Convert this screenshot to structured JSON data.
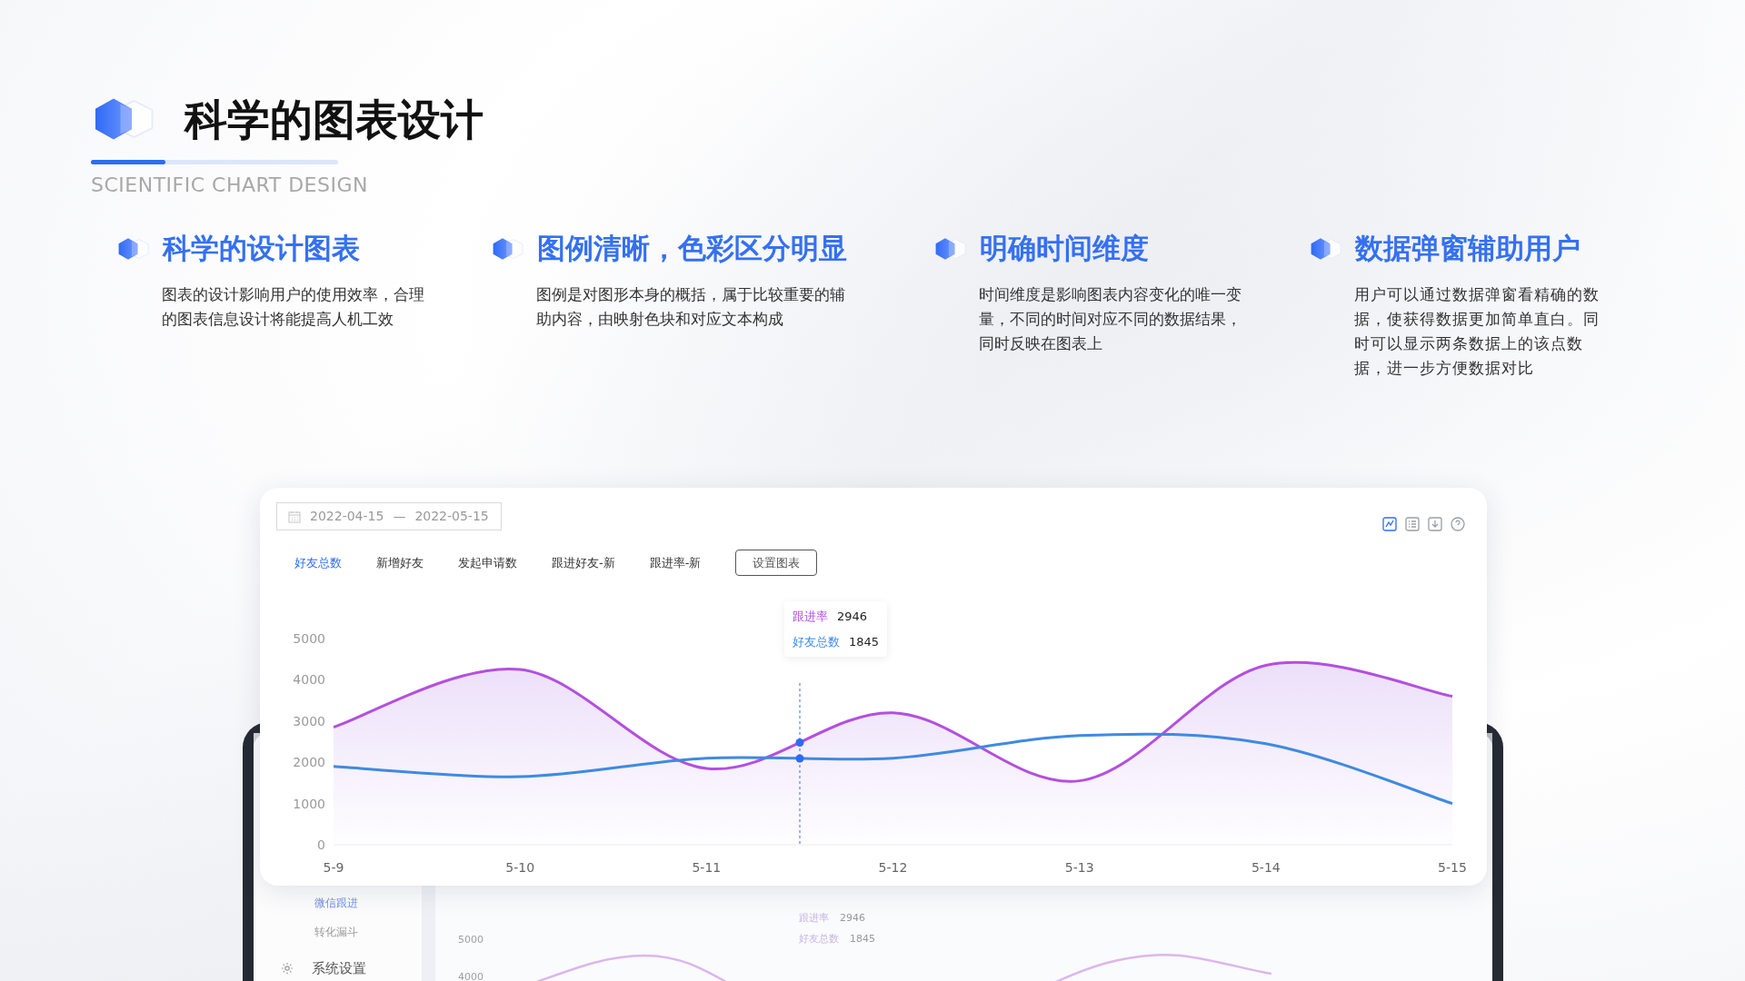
{
  "header": {
    "title": "科学的图表设计",
    "subtitle": "SCIENTIFIC CHART DESIGN",
    "progress": {
      "level": 0.3
    }
  },
  "features": [
    {
      "title": "科学的设计图表",
      "description": "图表的设计影响用户的使用效率，合理的图表信息设计将能提高人机工效"
    },
    {
      "title": "图例清晰，色彩区分明显",
      "description": "图例是对图形本身的概括，属于比较重要的辅助内容，由映射色块和对应文本构成"
    },
    {
      "title": "明确时间维度",
      "description": "时间维度是影响图表内容变化的唯一变量，不同的时间对应不同的数据结果，同时反映在图表上"
    },
    {
      "title": "数据弹窗辅助用户",
      "description": "用户可以通过数据弹窗看精确的数据，使获得数据更加简单直白。同时可以显示两条数据上的该点数据，进一步方便数据对比"
    }
  ],
  "panel": {
    "date_range": {
      "start": "2022-04-15",
      "separator": "—",
      "end": "2022-05-15"
    },
    "tabs": [
      {
        "label": "好友总数",
        "selected": true
      },
      {
        "label": "新增好友",
        "selected": false
      },
      {
        "label": "发起申请数",
        "selected": false
      },
      {
        "label": "跟进好友-新",
        "selected": false
      },
      {
        "label": "跟进率-新",
        "selected": false
      }
    ],
    "settings_button": "设置图表",
    "toolbar": [
      {
        "kind": "line-chart",
        "selected": true
      },
      {
        "kind": "list",
        "selected": false
      },
      {
        "kind": "download",
        "selected": false
      },
      {
        "kind": "help",
        "selected": false
      }
    ],
    "chart_data": {
      "type": "line",
      "categories": [
        "5-9",
        "5-10",
        "5-11",
        "5-12",
        "5-13",
        "5-14",
        "5-15"
      ],
      "ylim": [
        0,
        5000
      ],
      "yticks": [
        0,
        1000,
        2000,
        3000,
        4000,
        5000
      ],
      "series": [
        {
          "name": "跟进率",
          "color": "#b44fdf",
          "values": [
            2850,
            4250,
            1850,
            3200,
            1550,
            4350,
            3600
          ]
        },
        {
          "name": "好友总数",
          "color": "#3f8ae0",
          "values": [
            1900,
            1650,
            2100,
            2100,
            2650,
            2450,
            1000
          ]
        }
      ]
    },
    "tooltip": {
      "rows": [
        {
          "value": "2946"
        },
        {
          "value": "1845"
        }
      ]
    }
  },
  "background_screen": {
    "sidebar_items": [
      {
        "label": "微信跟进",
        "selected": true
      },
      {
        "label": "转化漏斗",
        "selected": false
      }
    ],
    "settings_item": "系统设置",
    "yticks": [
      "5000",
      "4000"
    ],
    "tooltip": [
      {
        "label": "跟进率",
        "value": "2946"
      },
      {
        "label": "好友总数",
        "value": "1845"
      }
    ]
  }
}
